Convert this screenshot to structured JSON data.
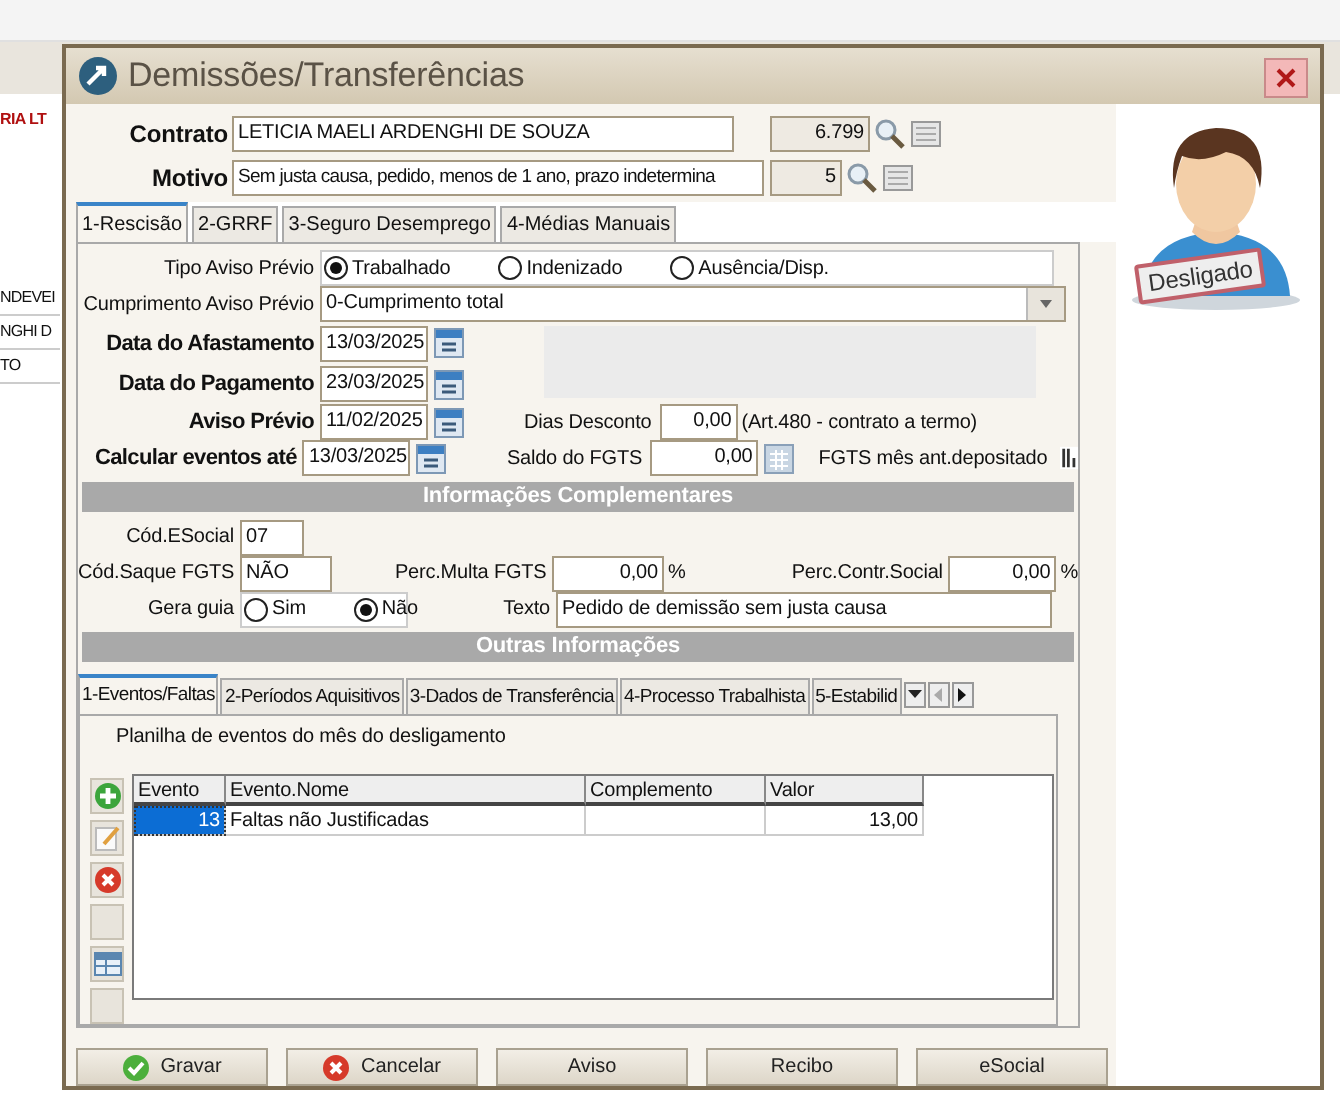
{
  "background": {
    "company": "RIA LT",
    "rows": [
      "NDEVEI",
      "NGHI D",
      "TO"
    ]
  },
  "window": {
    "title": "Demissões/Transferências"
  },
  "contrato": {
    "label": "Contrato",
    "value": "LETICIA MAELI ARDENGHI DE SOUZA",
    "code": "6.799"
  },
  "motivo": {
    "label": "Motivo",
    "value": "Sem justa causa, pedido, menos de 1 ano, prazo indetermina",
    "code": "5"
  },
  "tabs": [
    {
      "label": "1-Rescisão",
      "selected": true
    },
    {
      "label": "2-GRRF",
      "selected": false
    },
    {
      "label": "3-Seguro Desemprego",
      "selected": false
    },
    {
      "label": "4-Médias Manuais",
      "selected": false
    }
  ],
  "rescisao": {
    "tipo_aviso": {
      "label": "Tipo Aviso Prévio",
      "options": [
        {
          "label": "Trabalhado",
          "selected": true
        },
        {
          "label": "Indenizado",
          "selected": false
        },
        {
          "label": "Ausência/Disp.",
          "selected": false
        }
      ]
    },
    "cumprimento": {
      "label": "Cumprimento Aviso Prévio",
      "value": "0-Cumprimento total"
    },
    "dates": [
      {
        "label": "Data do Afastamento",
        "value": "13/03/2025"
      },
      {
        "label": "Data do Pagamento",
        "value": "23/03/2025"
      },
      {
        "label": "Aviso Prévio",
        "value": "11/02/2025"
      },
      {
        "label": "Calcular eventos até",
        "value": "13/03/2025"
      }
    ],
    "dias_desconto": {
      "label": "Dias Desconto",
      "value": "0,00",
      "note": "(Art.480 - contrato a termo)"
    },
    "saldo_fgts": {
      "label": "Saldo do FGTS",
      "value": "0,00"
    },
    "fgts_mes": {
      "label": "FGTS mês ant.depositado"
    }
  },
  "complementares": {
    "title": "Informações Complementares",
    "cod_esocial": {
      "label": "Cód.ESocial",
      "value": "07"
    },
    "cod_saque": {
      "label": "Cód.Saque FGTS",
      "value": "NÃO"
    },
    "perc_multa": {
      "label": "Perc.Multa FGTS",
      "value": "0,00",
      "unit": "%"
    },
    "perc_contr": {
      "label": "Perc.Contr.Social",
      "value": "0,00",
      "unit": "%"
    },
    "gera_guia": {
      "label": "Gera guia",
      "options": [
        {
          "label": "Sim",
          "selected": false
        },
        {
          "label": "Não",
          "selected": true
        }
      ]
    },
    "texto": {
      "label": "Texto",
      "value": "Pedido de demissão sem justa causa"
    }
  },
  "outras": {
    "title": "Outras Informações",
    "tabs": [
      {
        "label": "1-Eventos/Faltas",
        "selected": true
      },
      {
        "label": "2-Períodos Aquisitivos",
        "selected": false
      },
      {
        "label": "3-Dados de Transferência",
        "selected": false
      },
      {
        "label": "4-Processo Trabalhista",
        "selected": false
      },
      {
        "label": "5-Estabilid",
        "selected": false
      }
    ],
    "caption": "Planilha de eventos do mês do desligamento",
    "toolbar": [
      {
        "kind": "add"
      },
      {
        "kind": "edit"
      },
      {
        "kind": "delete"
      },
      {
        "kind": "blank"
      },
      {
        "kind": "grid"
      },
      {
        "kind": "blank"
      }
    ],
    "columns": [
      "Evento",
      "Evento.Nome",
      "Complemento",
      "Valor"
    ],
    "rows": [
      {
        "evento": "13",
        "nome": "Faltas não Justificadas",
        "valor": "13,00",
        "selected": true
      }
    ]
  },
  "buttons": [
    {
      "label": "Gravar",
      "kind": "confirm"
    },
    {
      "label": "Cancelar",
      "kind": "cancel"
    },
    {
      "label": "Aviso",
      "kind": "plain"
    },
    {
      "label": "Recibo",
      "kind": "plain"
    },
    {
      "label": "eSocial",
      "kind": "plain"
    }
  ],
  "avatar": {
    "badge": "Desligado"
  }
}
